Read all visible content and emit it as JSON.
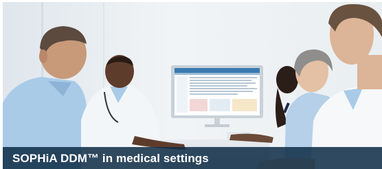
{
  "caption": {
    "text": "SOPHiA DDM™ in medical settings"
  },
  "colors": {
    "caption_bar": "#0e2c46",
    "caption_text": "#ffffff",
    "screen_header": "#3b7ab0",
    "scrub_blue": "#a9cbe8",
    "coat_white": "#f3f6f9"
  },
  "icons": [
    "monitor-icon"
  ]
}
